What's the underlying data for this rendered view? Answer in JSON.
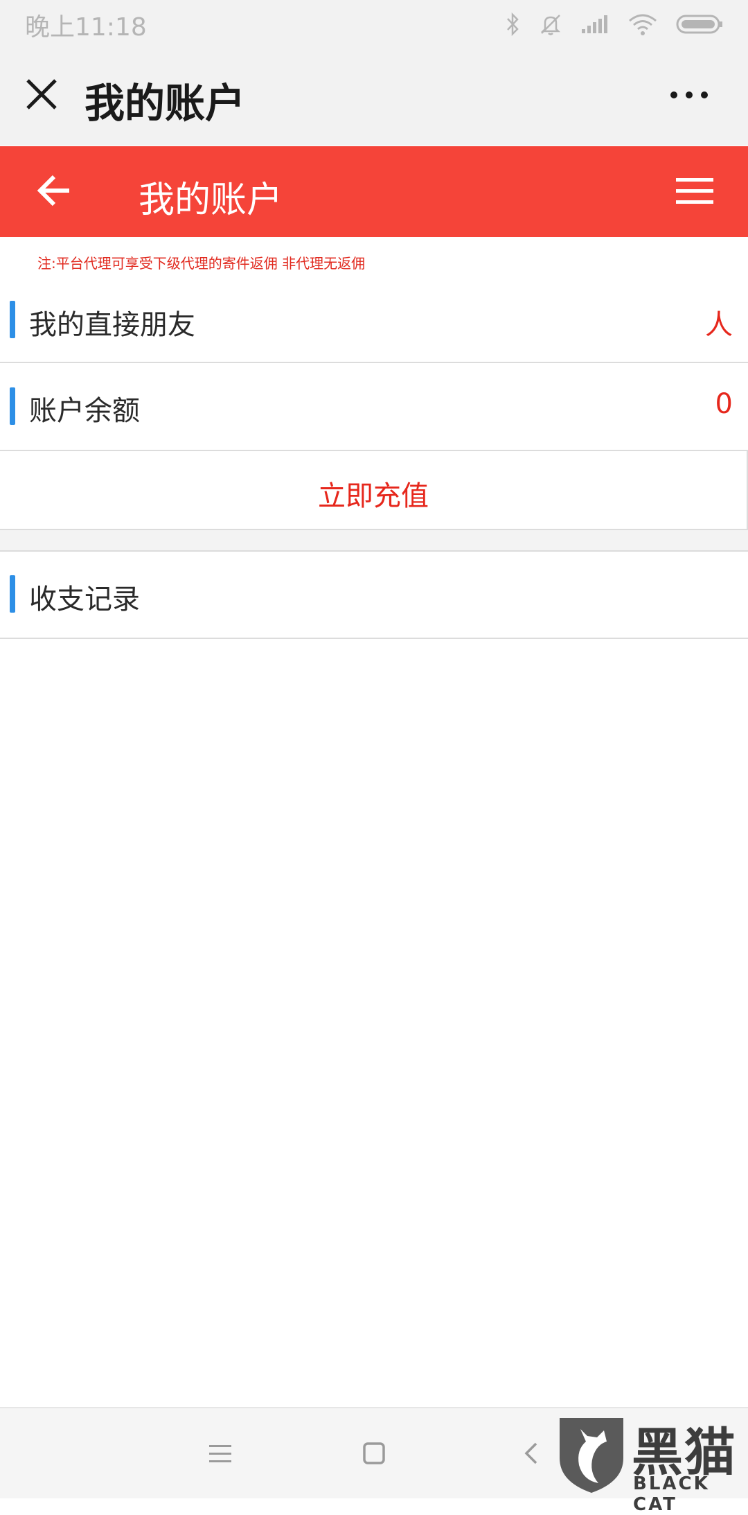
{
  "status_bar": {
    "time": "晚上11:18",
    "icons": [
      "bluetooth-icon",
      "mute-bell-icon",
      "signal-icon",
      "wifi-icon",
      "battery-icon"
    ]
  },
  "webview_bar": {
    "title": "我的账户",
    "close_icon": "close-icon",
    "more_icon": "more-icon"
  },
  "app_header": {
    "title": "我的账户",
    "back_icon": "back-arrow-icon",
    "menu_icon": "menu-icon",
    "color": "#f54439"
  },
  "note": "注:平台代理可享受下级代理的寄件返佣 非代理无返佣",
  "rows": {
    "friends": {
      "label": "我的直接朋友",
      "value": "人"
    },
    "balance": {
      "label": "账户余额",
      "value": "0"
    },
    "recharge": {
      "label": "立即充值"
    },
    "records": {
      "label": "收支记录"
    }
  },
  "accent_color": "#2d8fe6",
  "value_color": "#e6271c",
  "bottom_nav": [
    "menu-icon",
    "home-square-icon",
    "back-chevron-icon"
  ],
  "watermark": {
    "cn": "黑猫",
    "en": "BLACK CAT"
  }
}
